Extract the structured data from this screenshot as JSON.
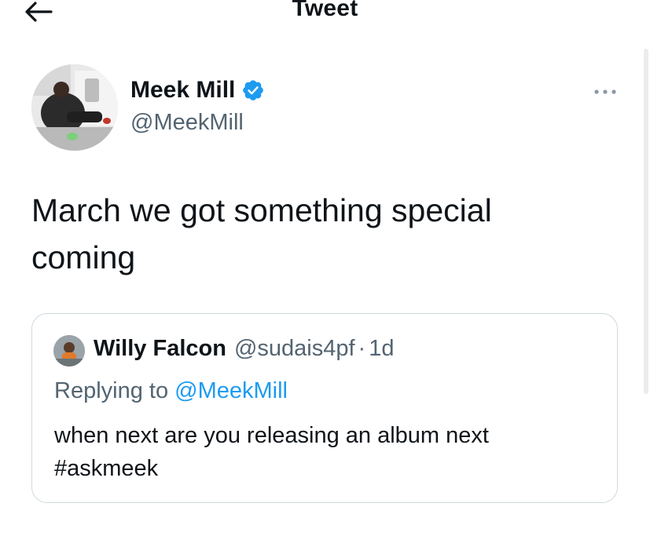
{
  "header": {
    "title": "Tweet",
    "back_icon": "arrow-left-icon"
  },
  "author": {
    "name": "Meek Mill",
    "handle": "@MeekMill",
    "verified_icon": "verified-badge-icon",
    "verified_color": "#1d9bf0"
  },
  "tweet": {
    "text": "March we got something special coming"
  },
  "more_icon": "more-horizontal-icon",
  "quoted_tweet": {
    "name": "Willy Falcon",
    "handle": "@sudais4pf",
    "separator": "·",
    "time": "1d",
    "replying_prefix": "Replying to",
    "replying_mention": "@MeekMill",
    "text": "when next are you releasing an album next #askmeek"
  },
  "colors": {
    "text_primary": "#0f1419",
    "text_secondary": "#536471",
    "accent": "#1d9bf0",
    "border": "#cfd9de"
  }
}
